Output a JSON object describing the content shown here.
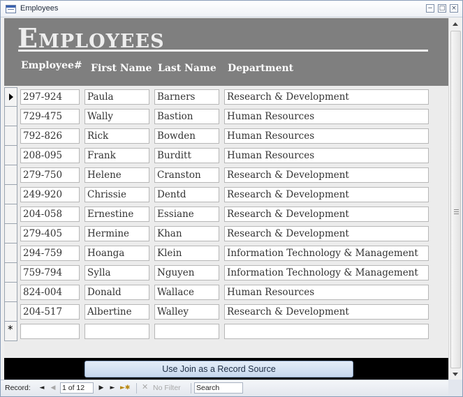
{
  "window": {
    "title": "Employees"
  },
  "form": {
    "title": "Employees",
    "columns": {
      "id": "Employee#",
      "first": "First Name",
      "last": "Last Name",
      "dept": "Department"
    },
    "records": [
      {
        "id": "297-924",
        "first": "Paula",
        "last": "Barners",
        "dept": "Research & Development"
      },
      {
        "id": "729-475",
        "first": "Wally",
        "last": "Bastion",
        "dept": "Human Resources"
      },
      {
        "id": "792-826",
        "first": "Rick",
        "last": "Bowden",
        "dept": "Human Resources"
      },
      {
        "id": "208-095",
        "first": "Frank",
        "last": "Burditt",
        "dept": "Human Resources"
      },
      {
        "id": "279-750",
        "first": "Helene",
        "last": "Cranston",
        "dept": "Research & Development"
      },
      {
        "id": "249-920",
        "first": "Chrissie",
        "last": "Dentd",
        "dept": "Research & Development"
      },
      {
        "id": "204-058",
        "first": "Ernestine",
        "last": "Essiane",
        "dept": "Research & Development"
      },
      {
        "id": "279-405",
        "first": "Hermine",
        "last": "Khan",
        "dept": "Research & Development"
      },
      {
        "id": "294-759",
        "first": "Hoanga",
        "last": "Klein",
        "dept": "Information Technology & Management"
      },
      {
        "id": "759-794",
        "first": "Sylla",
        "last": "Nguyen",
        "dept": "Information Technology & Management"
      },
      {
        "id": "824-004",
        "first": "Donald",
        "last": "Wallace",
        "dept": "Human Resources"
      },
      {
        "id": "204-517",
        "first": "Albertine",
        "last": "Walley",
        "dept": "Research & Development"
      }
    ],
    "new_record": {
      "id": "",
      "first": "",
      "last": "",
      "dept": ""
    },
    "new_record_marker": "*",
    "button_label": "Use Join as a Record Source"
  },
  "navbar": {
    "record_label": "Record:",
    "position": "1 of 12",
    "filter_label": "No Filter",
    "search_label": "Search"
  },
  "colors": {
    "header_bg": "#7f7f7f",
    "footer_bg": "#000000",
    "button_bg": "#c7d8ee"
  }
}
